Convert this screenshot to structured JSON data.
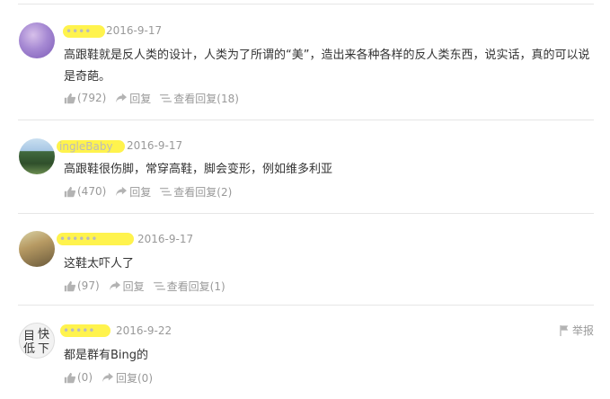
{
  "comments": [
    {
      "username": "••••",
      "date": "2016-9-17",
      "text": "高跟鞋就是反人类的设计，人类为了所谓的“美”，造出来各种各样的反人类东西，说实话，真的可以说是奇葩。",
      "likes": "(792)",
      "reply_label": "回复",
      "view_replies": "查看回复(18)"
    },
    {
      "username": "ingleBaby",
      "date": "2016-9-17",
      "text": "高跟鞋很伤脚，常穿高鞋，脚会变形，例如维多利亚",
      "likes": "(470)",
      "reply_label": "回复",
      "view_replies": "查看回复(2)"
    },
    {
      "username": "••••••",
      "date": "2016-9-17",
      "text": "这鞋太吓人了",
      "likes": "(97)",
      "reply_label": "回复",
      "view_replies": "查看回复(1)"
    },
    {
      "username": "•••••",
      "date": "2016-9-22",
      "text": "都是群有Bing的",
      "likes": "(0)",
      "reply_label": "回复(0)",
      "report_label": "举报",
      "avatar_chars": [
        "目",
        "快",
        "低",
        "下"
      ]
    }
  ],
  "colors": {
    "text": "#333333",
    "meta": "#999999",
    "highlight": "#fff34d",
    "divider": "#e6e6e6"
  },
  "icons": {
    "like": "thumbs-up-icon",
    "reply": "reply-arrow-icon",
    "list": "list-icon",
    "report": "flag-icon"
  }
}
